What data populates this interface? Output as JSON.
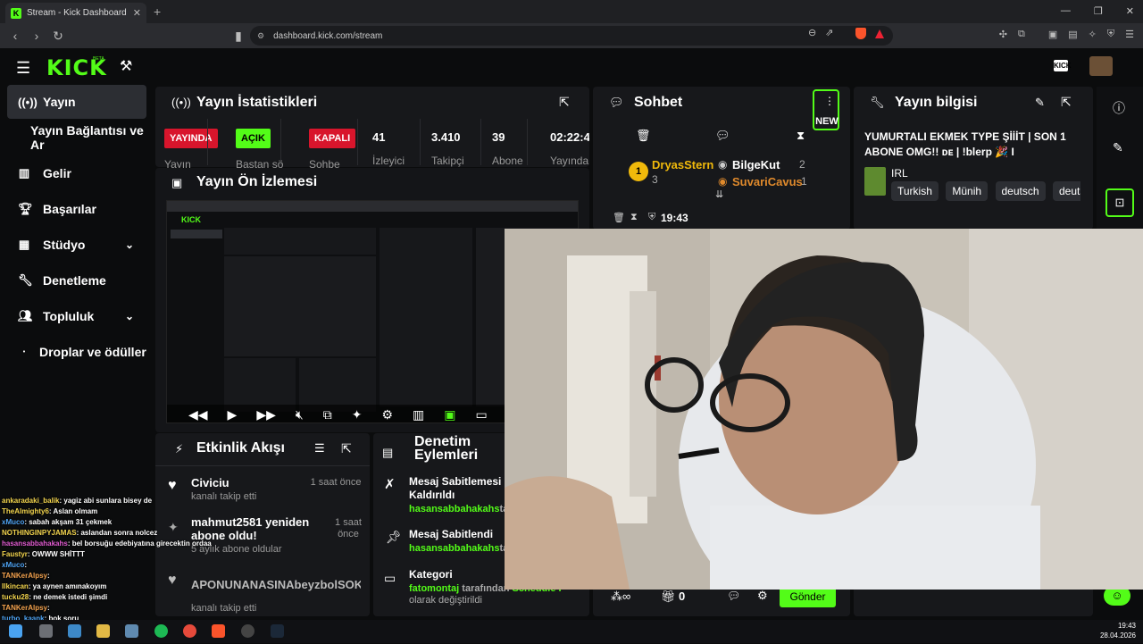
{
  "browser": {
    "tab_title": "Stream - Kick Dashboard",
    "url": "dashboard.kick.com/stream"
  },
  "header": {
    "logo": "KICK",
    "logo_sup": "BETA",
    "kick_badge": "KICK"
  },
  "sidebar": {
    "items": [
      {
        "label": "Yayın",
        "icon": "broadcast-icon"
      },
      {
        "label": "Yayın Bağlantısı ve Ar",
        "icon": ""
      },
      {
        "label": "Gelir",
        "icon": "chart-icon"
      },
      {
        "label": "Başarılar",
        "icon": "trophy-icon"
      },
      {
        "label": "Stüdyo",
        "icon": "studio-icon"
      },
      {
        "label": "Denetleme",
        "icon": "wrench-icon"
      },
      {
        "label": "Topluluk",
        "icon": "people-icon"
      },
      {
        "label": "Droplar ve ödüller",
        "icon": "dot-icon"
      }
    ]
  },
  "stats": {
    "title": "Yayın İstatistikleri",
    "badges": {
      "live": "YAYINDA",
      "open": "AÇIK",
      "closed": "KAPALI"
    },
    "viewers": "41",
    "followers": "3.410",
    "subs": "39",
    "duration": "02:22:4",
    "labels": {
      "l1": "Yayın",
      "l2": "Baştan sö",
      "l3": "Sohbe",
      "viewers": "İzleyici",
      "followers": "Takipçi",
      "subs": "Abone",
      "duration": "Yayında"
    }
  },
  "preview": {
    "title": "Yayın Ön İzlemesi"
  },
  "chat": {
    "title": "Sohbet",
    "new_badge": "NEW",
    "leader1_name": "DryasStern",
    "leader1_count": "3",
    "leader1_rank": "1",
    "leader2_name": "BilgeKut",
    "leader2_count": "2",
    "leader3_name": "SuvariCavus",
    "leader3_count": "1",
    "timer": "19:43",
    "send": "Gönder",
    "gift_count": "0"
  },
  "info": {
    "title": "Yayın bilgisi",
    "stream_title": "YUMURTALI EKMEK TYPE ŞİİİT | SON 1 ABONE OMG!! ᴅᴇ | !blerp 🎉 I",
    "category": "IRL",
    "tags": [
      "Turkish",
      "Münih",
      "deutsch",
      "deuts"
    ]
  },
  "events": {
    "title": "Etkinlik Akışı",
    "items": [
      {
        "name": "Civiciu",
        "sub": "kanalı takip etti",
        "time": "1 saat önce"
      },
      {
        "name": "mahmut2581 yeniden abone oldu!",
        "sub": "5 aylık abone oldular",
        "time": "1 saat önce"
      },
      {
        "name": "APONUNANASINAbeyzbolSOKAN",
        "sub": "kanalı takip etti",
        "time": ""
      }
    ]
  },
  "mod": {
    "title": "Denetim Eylemleri",
    "items": [
      {
        "title": "Mesaj Sabitlemesi Kaldırıldı",
        "user": "hasansabbahakahs",
        "suffix": "ta"
      },
      {
        "title": "Mesaj Sabitlendi",
        "user": "hasansabbahakahs",
        "suffix": "ta"
      },
      {
        "title": "Kategori",
        "user": "fatomontaj",
        "suffix": " tarafından",
        "line2": "olarak değiştirildi",
        "extra": "Schedule I"
      }
    ]
  },
  "overlay_chat": [
    {
      "user": "ankaradaki_balik",
      "msg": ": yagiz abi sunlara bisey de",
      "color": "#f3d54e"
    },
    {
      "user": "TheAlmighty6",
      "msg": ": Aslan olmam",
      "color": "#f3d54e"
    },
    {
      "user": "xMuco",
      "msg": ": sabah akşam 31 çekmek",
      "color": "#4ea3f3"
    },
    {
      "user": "NOTHINGINPYJAMAS",
      "msg": ": aslandan sonra nolcez",
      "color": "#f3d54e"
    },
    {
      "user": "hasansabbahakahs",
      "msg": ": bel borsuğu edebiyatına girecektin ordaa",
      "color": "#e05bd0"
    },
    {
      "user": "Faustyr",
      "msg": ": OWWW SHİTTT",
      "color": "#f3d54e"
    },
    {
      "user": "xMuco",
      "msg": ":",
      "color": "#4ea3f3"
    },
    {
      "user": "TANKerAlpsy",
      "msg": ":",
      "color": "#f3a24e"
    },
    {
      "user": "Ilkincan",
      "msg": ": ya aynen amınakoyım",
      "color": "#f3d54e"
    },
    {
      "user": "tucku28",
      "msg": ": ne demek istedi şimdi",
      "color": "#f3d54e"
    },
    {
      "user": "TANKerAlpsy",
      "msg": ":",
      "color": "#f3a24e"
    },
    {
      "user": "turbo_kaank",
      "msg": ": bok soru",
      "color": "#4ea3f3"
    }
  ],
  "clock": {
    "time": "19:43",
    "date": "28.04.2026"
  }
}
